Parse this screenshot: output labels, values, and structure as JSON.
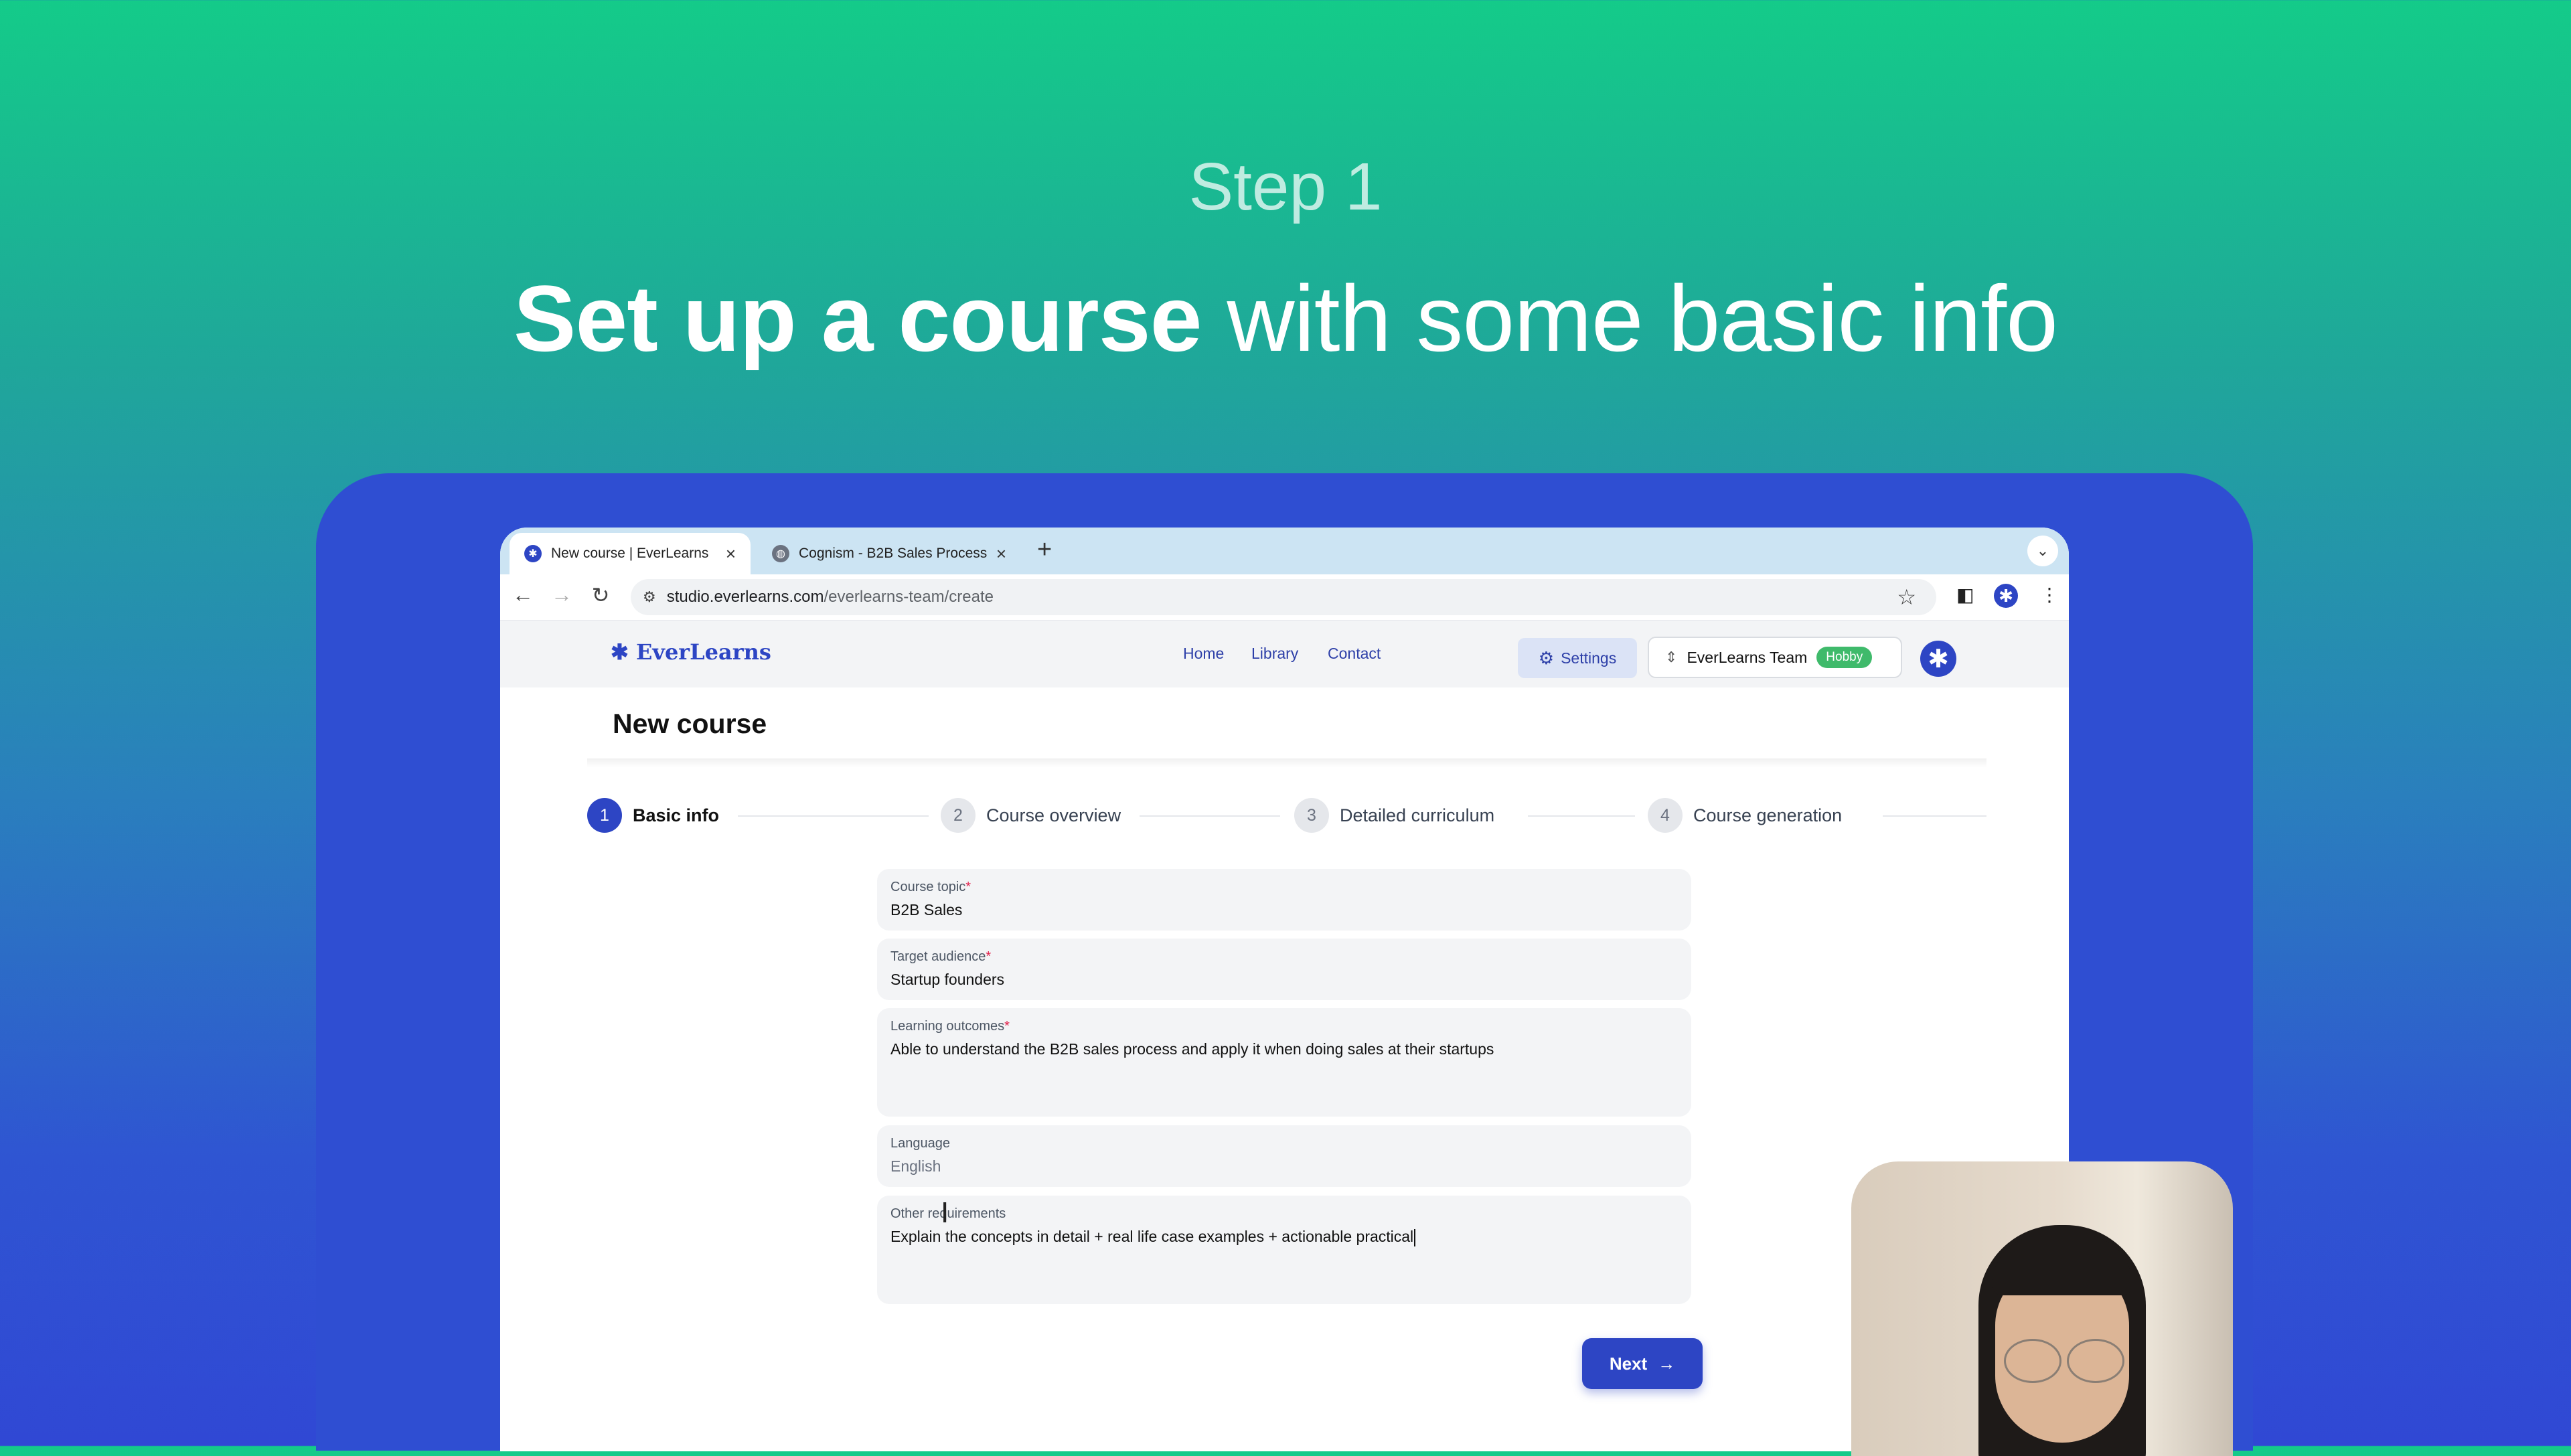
{
  "slide": {
    "step_label": "Step 1",
    "headline_bold": "Set up a course",
    "headline_rest": " with some basic info"
  },
  "browser": {
    "tabs": [
      {
        "title": "New course | EverLearns",
        "icon": "everlearns-icon",
        "active": true
      },
      {
        "title": "Cognism - B2B Sales Process",
        "icon": "globe-icon",
        "active": false
      }
    ],
    "url_host": "studio.everlearns.com",
    "url_path": "/everlearns-team/create"
  },
  "app": {
    "logo": "✱ EverLearns",
    "nav": [
      "Home",
      "Library",
      "Contact"
    ],
    "settings_label": "Settings",
    "team_name": "EverLearns Team",
    "plan_badge": "Hobby",
    "accent_color": "#2d45c4"
  },
  "page": {
    "title": "New course",
    "steps": [
      {
        "num": "1",
        "label": "Basic info",
        "active": true
      },
      {
        "num": "2",
        "label": "Course overview",
        "active": false
      },
      {
        "num": "3",
        "label": "Detailed curriculum",
        "active": false
      },
      {
        "num": "4",
        "label": "Course generation",
        "active": false
      }
    ],
    "form": {
      "topic": {
        "label": "Course topic",
        "required": "*",
        "value": "B2B Sales"
      },
      "audience": {
        "label": "Target audience",
        "required": "*",
        "value": "Startup founders"
      },
      "outcomes": {
        "label": "Learning outcomes",
        "required": "*",
        "value": "Able to understand the B2B sales process and apply it when doing sales at their startups"
      },
      "language": {
        "label": "Language",
        "value": "English"
      },
      "other": {
        "label": "Other requirements",
        "value": "Explain the concepts in detail + real life case examples + actionable practical"
      }
    },
    "next_label": "Next"
  }
}
